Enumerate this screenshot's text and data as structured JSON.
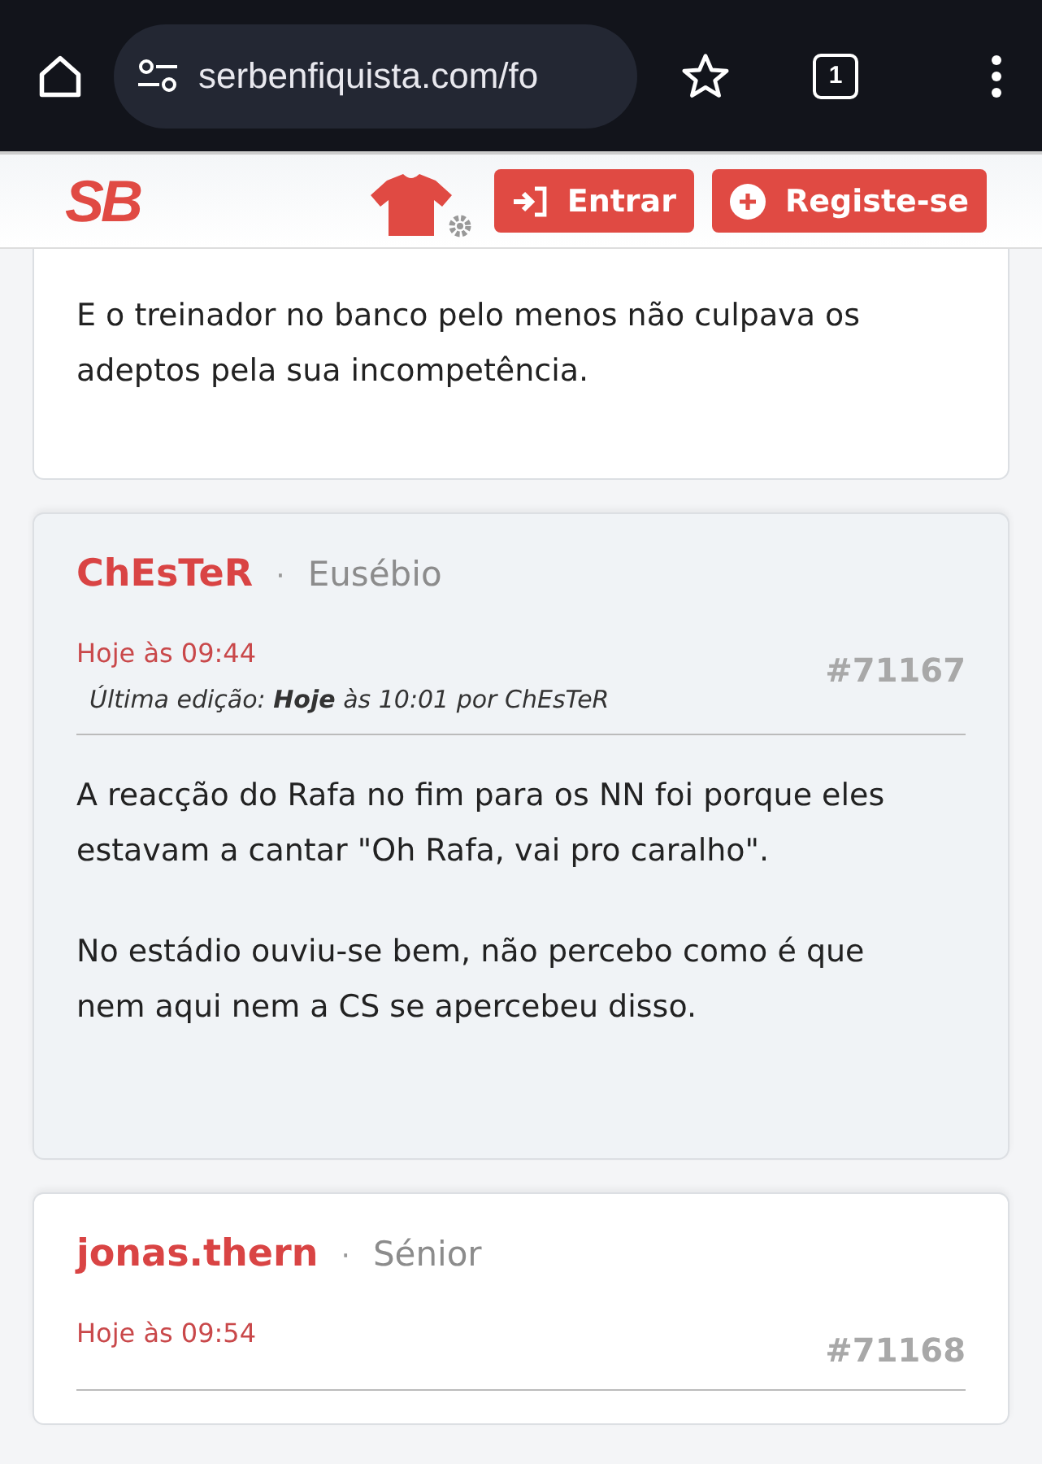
{
  "browser": {
    "url": "serbenfiquista.com/fo",
    "tab_count": "1"
  },
  "header": {
    "logo": "SB",
    "buttons": [
      {
        "kind": "login",
        "label": "Entrar"
      },
      {
        "kind": "register",
        "label": "Registe-se"
      }
    ]
  },
  "posts": [
    {
      "partial": true,
      "highlighted": false,
      "body": [
        "E o treinador no banco pelo menos não culpava os adeptos pela sua incompetência."
      ]
    },
    {
      "partial": false,
      "highlighted": true,
      "author": "ChEsTeR",
      "separator": "·",
      "rank": "Eusébio",
      "time": "Hoje às 09:44",
      "number": "#71167",
      "edit": "Última edição: **Hoje** às 10:01 por ChEsTeR",
      "body": [
        "A reacção do Rafa no fim para os NN foi porque eles estavam a cantar \"Oh Rafa, vai pro caralho\".",
        "No estádio ouviu-se bem, não percebo como é que nem aqui nem a CS se apercebeu disso."
      ]
    },
    {
      "partial": false,
      "highlighted": false,
      "author": "jonas.thern",
      "separator": "·",
      "rank": "Sénior",
      "time": "Hoje às 09:54",
      "number": "#71168"
    }
  ]
}
